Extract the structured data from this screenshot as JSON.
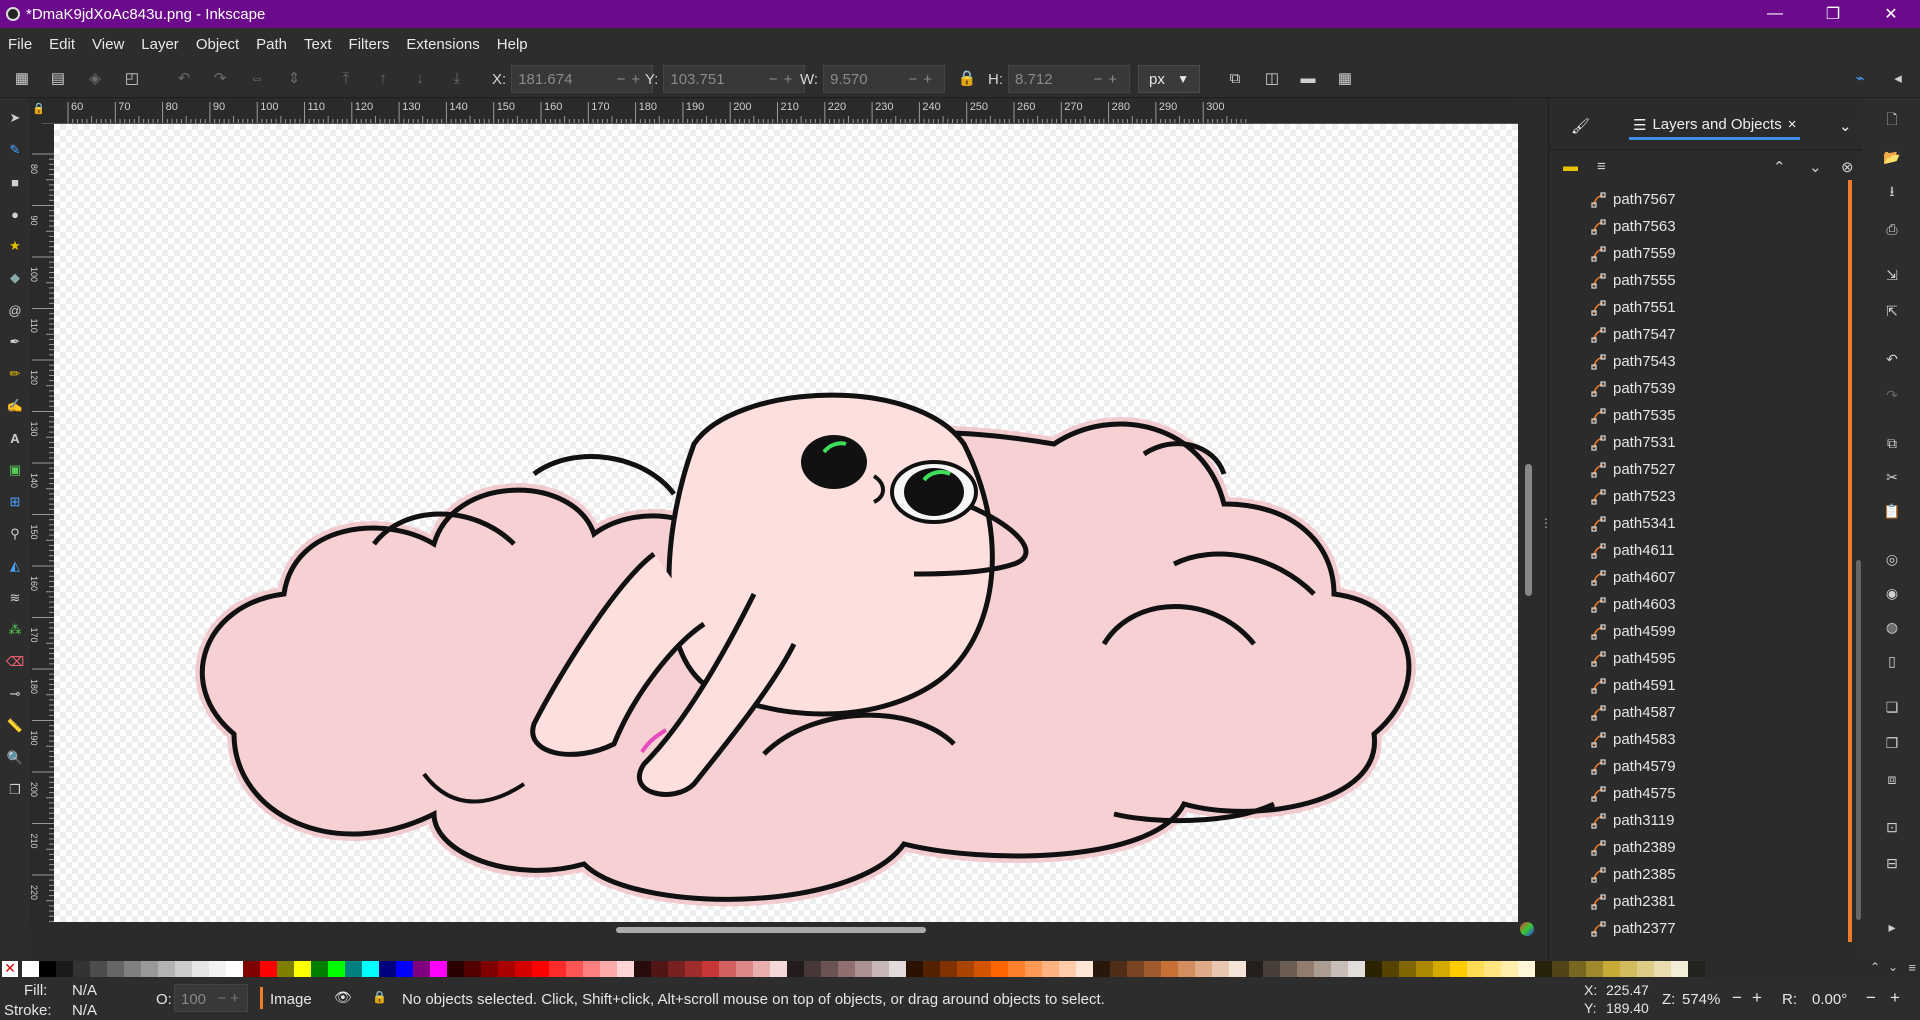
{
  "window": {
    "title": "*DmaK9jdXoAc843u.png - Inkscape",
    "minimize": "—",
    "restore": "❐",
    "close": "✕"
  },
  "menu": [
    "File",
    "Edit",
    "View",
    "Layer",
    "Object",
    "Path",
    "Text",
    "Filters",
    "Extensions",
    "Help"
  ],
  "toolbar": {
    "x_label": "X:",
    "x_value": "181.674",
    "y_label": "Y:",
    "y_value": "103.751",
    "w_label": "W:",
    "w_value": "9.570",
    "h_label": "H:",
    "h_value": "8.712",
    "unit": "px"
  },
  "ruler": {
    "h_ticks": [
      "60",
      "70",
      "80",
      "90",
      "100",
      "110",
      "120",
      "130",
      "140",
      "150",
      "160",
      "170",
      "180",
      "190",
      "200",
      "210",
      "220",
      "230",
      "240",
      "250",
      "260",
      "270",
      "280",
      "290",
      "300"
    ],
    "v_ticks": [
      "80",
      "90",
      "100",
      "110",
      "120",
      "130",
      "140",
      "150",
      "160",
      "170",
      "180",
      "190",
      "200",
      "210",
      "220"
    ],
    "page_badge": "1"
  },
  "panel": {
    "tab_label": "Layers and Objects",
    "tab_close": "×",
    "items": [
      "path7567",
      "path7563",
      "path7559",
      "path7555",
      "path7551",
      "path7547",
      "path7543",
      "path7539",
      "path7535",
      "path7531",
      "path7527",
      "path7523",
      "path5341",
      "path4611",
      "path4607",
      "path4603",
      "path4599",
      "path4595",
      "path4591",
      "path4587",
      "path4583",
      "path4579",
      "path4575",
      "path3119",
      "path2389",
      "path2385",
      "path2381",
      "path2377"
    ]
  },
  "status": {
    "fill_label": "Fill:",
    "fill_value": "N/A",
    "stroke_label": "Stroke:",
    "stroke_value": "N/A",
    "opacity_label": "O:",
    "opacity_value": "100",
    "layer_name": "Image",
    "message": "No objects selected. Click, Shift+click, Alt+scroll mouse on top of objects, or drag around objects to select.",
    "x_label": "X:",
    "x_value": "225.47",
    "y_label": "Y:",
    "y_value": "189.40",
    "zoom_label": "Z:",
    "zoom_value": "574%",
    "rotation_label": "R:",
    "rotation_value": "0.00°"
  },
  "palette": [
    "#ffffff",
    "#000000",
    "#1a1a1a",
    "#333333",
    "#4d4d4d",
    "#666666",
    "#808080",
    "#999999",
    "#b3b3b3",
    "#cccccc",
    "#e6e6e6",
    "#f2f2f2",
    "#ffffff",
    "#800000",
    "#ff0000",
    "#808000",
    "#ffff00",
    "#008000",
    "#00ff00",
    "#008080",
    "#00ffff",
    "#000080",
    "#0000ff",
    "#800080",
    "#ff00ff",
    "#2b0000",
    "#550000",
    "#800000",
    "#aa0000",
    "#d40000",
    "#ff0000",
    "#ff2a2a",
    "#ff5555",
    "#ff8080",
    "#ffaaaa",
    "#ffd5d5",
    "#280b0b",
    "#501616",
    "#782121",
    "#a02c2c",
    "#c83737",
    "#d35f5f",
    "#de8787",
    "#e9afaf",
    "#f4d7d7",
    "#241c1c",
    "#483737",
    "#6c5353",
    "#916f6f",
    "#ac9393",
    "#c8b7b7",
    "#e3dbdb",
    "#2b1100",
    "#552200",
    "#803300",
    "#aa4400",
    "#d45500",
    "#ff6600",
    "#ff7f2a",
    "#ff9955",
    "#ffb380",
    "#ffccaa",
    "#ffe6d5",
    "#28170b",
    "#502d16",
    "#784421",
    "#a05a2c",
    "#c87137",
    "#d38d5f",
    "#deaa87",
    "#e9c6af",
    "#f4e3d7",
    "#241f1c",
    "#483e37",
    "#6c5d53",
    "#917c6f",
    "#ac9d93",
    "#c8beb7",
    "#e3dedb",
    "#2b2200",
    "#554400",
    "#806600",
    "#aa8800",
    "#d4aa00",
    "#ffcc00",
    "#ffdd55",
    "#ffe680",
    "#ffeeaa",
    "#fff6d5",
    "#28220b",
    "#504416",
    "#786721",
    "#a0892c",
    "#c8ab37",
    "#d3bc5f",
    "#decd87",
    "#e9ddaf",
    "#f4eed7",
    "#24221c"
  ]
}
